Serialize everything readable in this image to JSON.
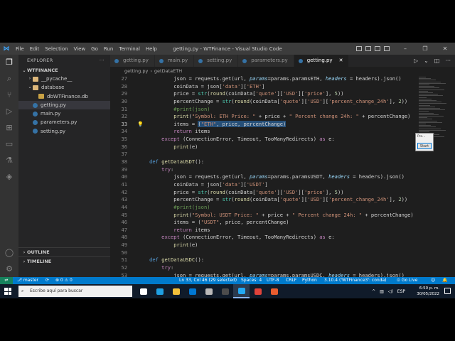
{
  "window": {
    "title": "getting.py - WTFinance - Visual Studio Code",
    "menu": [
      "File",
      "Edit",
      "Selection",
      "View",
      "Go",
      "Run",
      "Terminal",
      "Help"
    ],
    "controls": [
      "–",
      "❐",
      "✕"
    ]
  },
  "activity_bar": [
    "files-icon",
    "search-icon",
    "source-control-icon",
    "run-debug-icon",
    "extensions-icon",
    "remote-explorer-icon",
    "testing-icon",
    "python-icon"
  ],
  "sidebar": {
    "header": "EXPLORER",
    "header_menu": "···",
    "project": "WTFINANCE",
    "items": [
      {
        "label": "__pycache__",
        "type": "folder",
        "depth": 1,
        "chevron": "›"
      },
      {
        "label": "database",
        "type": "folder",
        "depth": 1,
        "chevron": "⌄"
      },
      {
        "label": "dbWTFinance.db",
        "type": "db",
        "depth": 2,
        "chevron": ""
      },
      {
        "label": "getting.py",
        "type": "py",
        "depth": 1,
        "chevron": "",
        "selected": true
      },
      {
        "label": "main.py",
        "type": "py",
        "depth": 1,
        "chevron": ""
      },
      {
        "label": "parameters.py",
        "type": "py",
        "depth": 1,
        "chevron": ""
      },
      {
        "label": "setting.py",
        "type": "py",
        "depth": 1,
        "chevron": ""
      }
    ],
    "outline": "OUTLINE",
    "timeline": "TIMELINE"
  },
  "tabs": [
    {
      "label": "getting.py",
      "active": false
    },
    {
      "label": "main.py",
      "active": false
    },
    {
      "label": "setting.py",
      "active": false
    },
    {
      "label": "parameters.py",
      "active": false
    },
    {
      "label": "getting.py",
      "active": true,
      "close": "✕"
    }
  ],
  "tab_actions": [
    "▷",
    "⌄",
    "◫",
    "···"
  ],
  "breadcrumb": [
    "getting.py",
    "›",
    "getDataETH"
  ],
  "code_lines": [
    {
      "n": "27",
      "html": "            json = requests.get(url, <span class='it'>params</span>=params.paramsETH, <span class='it'>headers</span> = headers).json()"
    },
    {
      "n": "28",
      "html": "            coinData = json[<span class='st'>'data'</span>][<span class='st'>'ETH'</span>]"
    },
    {
      "n": "29",
      "html": "            price = <span class='cl'>str</span>(<span class='fn'>round</span>(coinData[<span class='st'>'quote'</span>][<span class='st'>'USD'</span>][<span class='st'>'price'</span>], <span class='nm'>5</span>))"
    },
    {
      "n": "30",
      "html": "            percentChange = <span class='cl'>str</span>(<span class='fn'>round</span>(coinData[<span class='st'>'quote'</span>][<span class='st'>'USD'</span>][<span class='st'>'percent_change_24h'</span>], <span class='nm'>2</span>))"
    },
    {
      "n": "31",
      "html": "            <span class='cm'>#print(json)</span>"
    },
    {
      "n": "32",
      "html": "            <span class='fn'>print</span>(<span class='st'>\"Symbol: ETH Price: \"</span> + price + <span class='st'>\" Percent change 24h: \"</span> + percentChange)"
    },
    {
      "n": "33",
      "html": "            items = <span class='selhl'>(<span class='st'>\"ETH\"</span>, price, percentChange)</span>",
      "current": true,
      "bulb": true
    },
    {
      "n": "34",
      "html": "            <span class='kw'>return</span> items"
    },
    {
      "n": "35",
      "html": "        <span class='kw'>except</span> (ConnectionError, Timeout, TooManyRedirects) <span class='kw'>as</span> e:"
    },
    {
      "n": "36",
      "html": "            <span class='fn'>print</span>(e)"
    },
    {
      "n": "37",
      "html": ""
    },
    {
      "n": "38",
      "html": "    <span class='df'>def</span> <span class='fn'>getDataUSDT</span>():"
    },
    {
      "n": "39",
      "html": "        <span class='kw'>try</span>:"
    },
    {
      "n": "40",
      "html": "            json = requests.get(url, <span class='it'>params</span>=params.paramsUSDT, <span class='it'>headers</span> = headers).json()"
    },
    {
      "n": "41",
      "html": "            coinData = json[<span class='st'>'data'</span>][<span class='st'>'USDT'</span>]"
    },
    {
      "n": "42",
      "html": "            price = <span class='cl'>str</span>(<span class='fn'>round</span>(coinData[<span class='st'>'quote'</span>][<span class='st'>'USD'</span>][<span class='st'>'price'</span>], <span class='nm'>5</span>))"
    },
    {
      "n": "43",
      "html": "            percentChange = <span class='cl'>str</span>(<span class='fn'>round</span>(coinData[<span class='st'>'quote'</span>][<span class='st'>'USD'</span>][<span class='st'>'percent_change_24h'</span>], <span class='nm'>2</span>))"
    },
    {
      "n": "44",
      "html": "            <span class='cm'>#print(json)</span>"
    },
    {
      "n": "45",
      "html": "            <span class='fn'>print</span>(<span class='st'>\"Symbol: USDT Price: \"</span> + price + <span class='st'>\" Percent change 24h: \"</span> + percentChange)"
    },
    {
      "n": "46",
      "html": "            items = (<span class='st'>\"USDT\"</span>, price, percentChange)"
    },
    {
      "n": "47",
      "html": "            <span class='kw'>return</span> items"
    },
    {
      "n": "48",
      "html": "        <span class='kw'>except</span> (ConnectionError, Timeout, TooManyRedirects) <span class='kw'>as</span> e:"
    },
    {
      "n": "49",
      "html": "            <span class='fn'>print</span>(e)"
    },
    {
      "n": "50",
      "html": ""
    },
    {
      "n": "51",
      "html": "    <span class='df'>def</span> <span class='fn'>getDataUSDC</span>():"
    },
    {
      "n": "52",
      "html": "        <span class='kw'>try</span>:"
    },
    {
      "n": "53",
      "html": "            json = requests.get(url, <span class='it'>params</span>=params.paramsUSDC, <span class='it'>headers</span> = headers).json()"
    }
  ],
  "popup": {
    "title": "Pro...",
    "button": "Start"
  },
  "status": {
    "remote": "⇌",
    "branch": "⎇ master",
    "sync": "⟳",
    "problems": "⊗ 0 ⚠ 0",
    "position": "Ln 33, Col 46 (29 selected)",
    "spaces": "Spaces: 4",
    "encoding": "UTF-8",
    "eol": "CRLF",
    "language": "Python",
    "interpreter": "3.10.4 ('WTFinance3': conda)",
    "golive": "⊙ Go Live",
    "feedback": "☺",
    "bell": "🔔"
  },
  "taskbar": {
    "search_placeholder": "Escribe aquí para buscar",
    "apps": [
      {
        "name": "task-view-icon",
        "color": "#ffffff",
        "on": false
      },
      {
        "name": "edge-icon",
        "color": "#1fa0e3",
        "on": false
      },
      {
        "name": "file-explorer-icon",
        "color": "#f3c13a",
        "on": false
      },
      {
        "name": "mail-icon",
        "color": "#0078d4",
        "on": false
      },
      {
        "name": "notes-icon",
        "color": "#b9b9b9",
        "on": false
      },
      {
        "name": "store-icon",
        "color": "#4c4c4c",
        "on": false
      },
      {
        "name": "vscode-icon",
        "color": "#23a9f2",
        "on": true
      },
      {
        "name": "chrome-icon",
        "color": "#e0433a",
        "on": false
      },
      {
        "name": "app-icon",
        "color": "#e85d2f",
        "on": false
      }
    ],
    "tray_lang": "ESP",
    "time": "6:50 p. m.",
    "date": "30/05/2022"
  },
  "colors": {
    "accent": "#007acc",
    "editor_bg": "#1e1e1e",
    "sidebar_bg": "#252526"
  }
}
